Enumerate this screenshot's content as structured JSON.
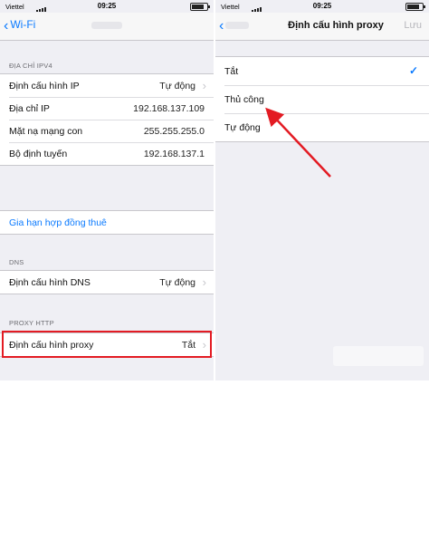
{
  "left": {
    "status": {
      "carrier": "Viettel",
      "time": "09:25"
    },
    "nav": {
      "back_label": "Wi-Fi"
    },
    "sections": {
      "ipv4_header": "ĐỊA CHỈ IPV4",
      "dns_header": "DNS",
      "proxy_header": "PROXY HTTP"
    },
    "ipv4_rows": [
      {
        "label": "Định cấu hình IP",
        "value": "Tự động"
      },
      {
        "label": "Địa chỉ IP",
        "value": "192.168.137.109"
      },
      {
        "label": "Mặt nạ mạng con",
        "value": "255.255.255.0"
      },
      {
        "label": "Bộ định tuyến",
        "value": "192.168.137.1"
      }
    ],
    "renew_lease": "Gia hạn hợp đồng thuê",
    "dns_row": {
      "label": "Định cấu hình DNS",
      "value": "Tự động"
    },
    "proxy_row": {
      "label": "Định cấu hình proxy",
      "value": "Tắt"
    }
  },
  "right": {
    "status": {
      "carrier": "Viettel",
      "time": "09:25"
    },
    "nav": {
      "title": "Định cấu hình proxy",
      "save_label": "Lưu"
    },
    "options": [
      {
        "label": "Tắt",
        "selected": true
      },
      {
        "label": "Thủ công",
        "selected": false
      },
      {
        "label": "Tự động",
        "selected": false
      }
    ]
  },
  "annotation": {
    "highlight_color": "#e31b23",
    "arrow_color": "#e31b23"
  },
  "colors": {
    "accent": "#0a7aff",
    "background": "#efeff4"
  }
}
